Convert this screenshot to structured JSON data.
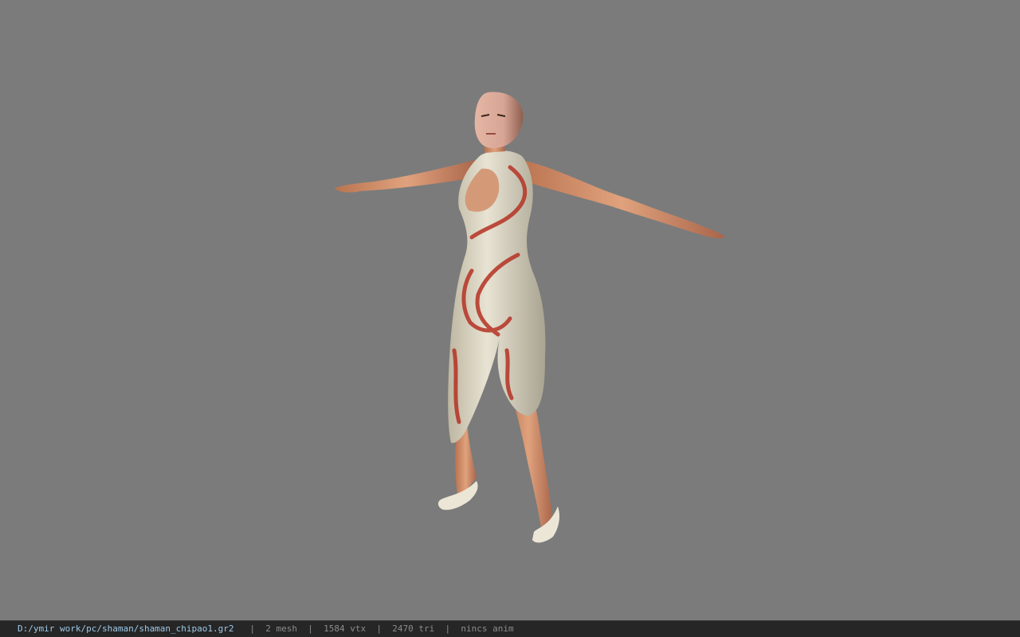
{
  "viewer": {
    "background_color": "#7b7b7b",
    "statusbar_color": "#262626"
  },
  "model": {
    "description_icon": "character-mesh-icon"
  },
  "status": {
    "file_path": "D:/ymir work/pc/shaman/shaman_chipao1.gr2",
    "separator": "|",
    "mesh": "2 mesh",
    "vertices": "1584 vtx",
    "triangles": "2470 tri",
    "animation": "nincs anim"
  }
}
